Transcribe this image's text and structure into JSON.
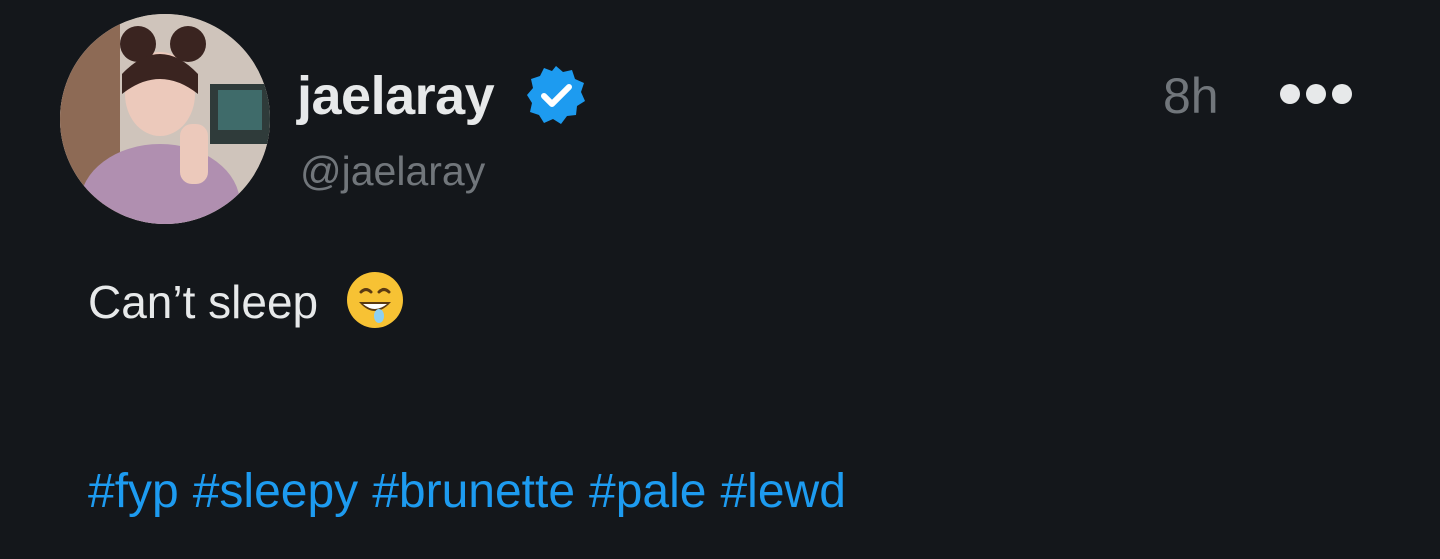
{
  "post": {
    "author": {
      "display_name": "jaelaray",
      "handle": "@jaelaray",
      "verified": true,
      "verified_icon": "verified-badge-icon",
      "avatar": "profile-photo"
    },
    "timestamp": "8h",
    "more_icon": "more-options-icon",
    "text": "Can’t sleep",
    "emoji": "drooling-face-emoji",
    "hashtags": [
      "#fyp",
      "#sleepy",
      "#brunette",
      "#pale",
      "#lewd"
    ]
  },
  "colors": {
    "background": "#14171b",
    "primary_text": "#e7e9ea",
    "secondary_text": "#71767b",
    "accent": "#1d9bf0"
  }
}
